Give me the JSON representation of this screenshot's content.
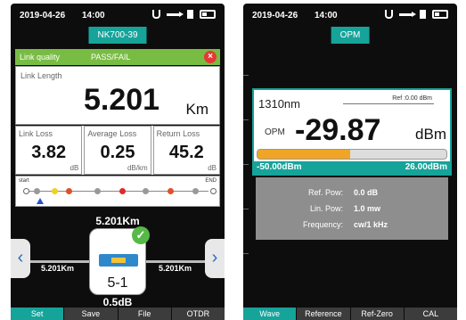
{
  "left": {
    "status": {
      "date": "2019-04-26",
      "time": "14:00"
    },
    "title": "NK700-39",
    "link_quality": {
      "label": "Link quality",
      "value": "PASS/FAIL",
      "close_symbol": "×"
    },
    "link_length": {
      "label": "Link Length",
      "value": "5.201",
      "unit": "Km"
    },
    "stats": [
      {
        "label": "Link Loss",
        "value": "3.82",
        "unit": "dB"
      },
      {
        "label": "Average Loss",
        "value": "0.25",
        "unit": "dB/km"
      },
      {
        "label": "Return Loss",
        "value": "45.2",
        "unit": "dB"
      }
    ],
    "event_bar": {
      "start": "start",
      "end": "END"
    },
    "top_distance": "5.201Km",
    "left_distance": "5.201Km",
    "right_distance": "5.201Km",
    "connector_label": "5-1",
    "loss_label": "0.5dB",
    "arrows": {
      "left": "‹",
      "right": "›"
    },
    "check_symbol": "✓",
    "tabs": [
      {
        "label": "Set",
        "active": true
      },
      {
        "label": "Save",
        "active": false
      },
      {
        "label": "File",
        "active": false
      },
      {
        "label": "OTDR",
        "active": false
      }
    ]
  },
  "right": {
    "status": {
      "date": "2019-04-26",
      "time": "14:00"
    },
    "title": "OPM",
    "wavelength": "1310nm",
    "ref": "Ref :0.00  dBm",
    "opm_label": "OPM",
    "value": "-29.87",
    "unit": "dBm",
    "power_fraction": 0.49,
    "range_min": "-50.00dBm",
    "range_max": "26.00dBm",
    "info": [
      {
        "key": "Ref. Pow:",
        "value": "0.0 dB"
      },
      {
        "key": "Lin. Pow:",
        "value": "1.0 mw"
      },
      {
        "key": "Frequency:",
        "value": "cw/1 kHz"
      }
    ],
    "tabs": [
      {
        "label": "Wave",
        "active": true
      },
      {
        "label": "Reference",
        "active": false
      },
      {
        "label": "Ref-Zero",
        "active": false
      },
      {
        "label": "CAL",
        "active": false
      }
    ]
  },
  "colors": {
    "accent": "#16a39a",
    "pass_green": "#79bc44",
    "close_red": "#e53935",
    "bar_orange": "#f0a526",
    "screen_bg": "#0d0d0d"
  },
  "icons": [
    "plug-icon",
    "usb-icon",
    "sd-card-icon",
    "battery-icon",
    "close-icon",
    "check-icon",
    "chevron-left-icon",
    "chevron-right-icon"
  ]
}
